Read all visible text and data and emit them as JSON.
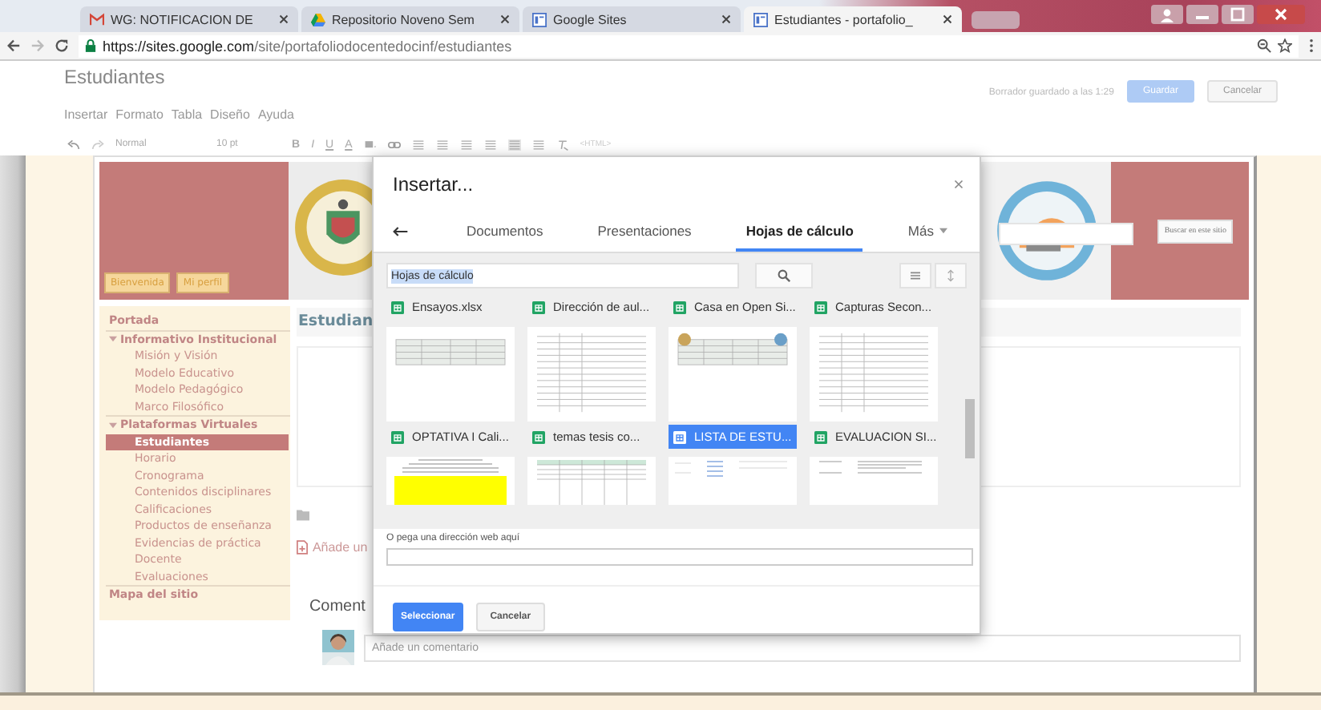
{
  "browser": {
    "tabs": [
      {
        "title": "WG: NOTIFICACION DE",
        "kind": "mail",
        "selected": false
      },
      {
        "title": "Repositorio Noveno Sem",
        "kind": "drive",
        "selected": false
      },
      {
        "title": "Google Sites",
        "kind": "sites",
        "selected": false
      },
      {
        "title": "Estudiantes - portafolio_",
        "kind": "sites",
        "selected": true
      }
    ],
    "url_host": "https://sites.google.com",
    "url_path": "/site/portafoliodocentedocinf/estudiantes"
  },
  "editor": {
    "page_title": "Estudiantes",
    "menu": [
      "Insertar",
      "Formato",
      "Tabla",
      "Diseño",
      "Ayuda"
    ],
    "draft_status": "Borrador guardado a las 1:29",
    "save_button": "Guardar",
    "cancel_button": "Cancelar",
    "toolbar": {
      "style": "Normal",
      "size": "10 pt",
      "bold": "B",
      "italic": "I",
      "underline": "U",
      "text_color": "A",
      "html": "<HTML>"
    }
  },
  "site": {
    "nav_buttons": [
      "Bienvenida",
      "Mi perfil"
    ],
    "search_button": "Buscar en este sitio",
    "sidebar": [
      {
        "label": "Portada",
        "selected": false
      },
      {
        "label": "Informativo Institucional",
        "selected": false,
        "expanded": true,
        "children": [
          {
            "label": "Misión y Visión",
            "selected": false
          },
          {
            "label": "Modelo Educativo",
            "selected": false
          },
          {
            "label": "Modelo Pedagógico",
            "selected": false
          },
          {
            "label": "Marco Filosófico",
            "selected": false
          }
        ]
      },
      {
        "label": "Plataformas Virtuales",
        "selected": false,
        "expanded": true,
        "children": [
          {
            "label": "Estudiantes",
            "selected": true
          },
          {
            "label": "Horario",
            "selected": false
          },
          {
            "label": "Cronograma",
            "selected": false
          },
          {
            "label": "Contenidos disciplinares",
            "selected": false
          },
          {
            "label": "Calificaciones",
            "selected": false
          },
          {
            "label": "Productos de enseñanza",
            "selected": false
          },
          {
            "label": "Evidencias de práctica Docente",
            "selected": false
          },
          {
            "label": "Evaluaciones",
            "selected": false
          }
        ]
      },
      {
        "label": "Mapa del sitio",
        "selected": false
      }
    ],
    "heading": "Estudian",
    "attach_text": "Añade un",
    "comments_heading": "Coment",
    "comment_placeholder": "Añade un comentario"
  },
  "dialog": {
    "title": "Insertar...",
    "tabs": [
      {
        "label": "Documentos",
        "selected": false
      },
      {
        "label": "Presentaciones",
        "selected": false
      },
      {
        "label": "Hojas de cálculo",
        "selected": true
      },
      {
        "label": "Más",
        "selected": false
      }
    ],
    "search_value": "Hojas de cálculo",
    "file_rows": [
      {
        "kind": "name_only",
        "files": [
          {
            "name": "Ensayos.xlsx",
            "selected": false
          },
          {
            "name": "Dirección de aul...",
            "selected": false
          },
          {
            "name": "Casa en Open Si...",
            "selected": false
          },
          {
            "name": "Capturas Secon...",
            "selected": false
          }
        ]
      },
      {
        "kind": "full",
        "files": [
          {
            "name": "OPTATIVA I Cali...",
            "selected": false
          },
          {
            "name": "temas tesis co...",
            "selected": false
          },
          {
            "name": "LISTA DE ESTU...",
            "selected": true
          },
          {
            "name": "EVALUACION SI...",
            "selected": false
          }
        ]
      },
      {
        "kind": "thumb_only",
        "files": [
          {
            "kind": "highlight"
          },
          {
            "kind": "grid"
          },
          {
            "kind": "list"
          },
          {
            "kind": "text"
          }
        ]
      }
    ],
    "url_label": "O pega una dirección web aquí",
    "select_button": "Seleccionar",
    "cancel_button": "Cancelar"
  }
}
